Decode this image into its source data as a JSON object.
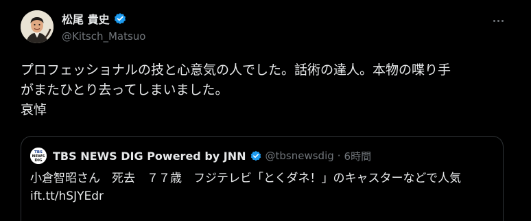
{
  "author": {
    "display_name": "松尾 貴史",
    "handle": "@Kitsch_Matsuo",
    "verified": true
  },
  "menu": {
    "more_icon": "more-horizontal-icon"
  },
  "tweet": {
    "text": "プロフェッショナルの技と心意気の人でした。話術の達人。本物の喋り手\nがまたひとり去ってしまいました。\n哀悼"
  },
  "quoted": {
    "avatar_label_line1": "TBS",
    "avatar_label_line2": "NEWS",
    "avatar_label_line3": "DIG",
    "display_name": "TBS NEWS DIG Powered by JNN",
    "handle": "@tbsnewsdig",
    "separator": "·",
    "time": "6時間",
    "text": "小倉智昭さん　死去　７７歳　フジテレビ「とくダネ！」のキャスターなどで人気 ift.tt/hSJYEdr"
  },
  "colors": {
    "background": "#000000",
    "text": "#e7e9ea",
    "secondary": "#71767b",
    "border": "#2f3336",
    "verified": "#1d9bf0"
  }
}
